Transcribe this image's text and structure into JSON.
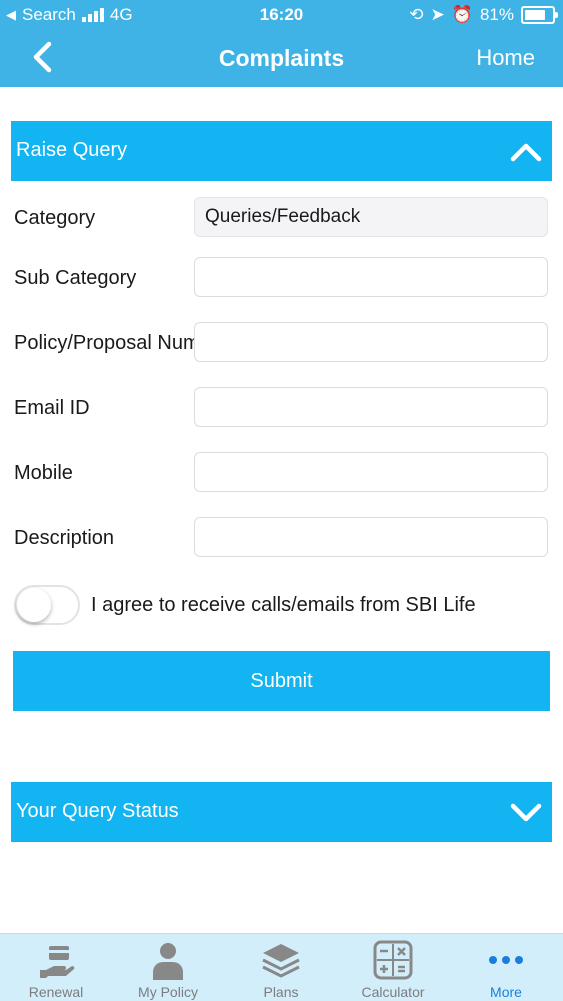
{
  "status_bar": {
    "carrier": "Search",
    "network": "4G",
    "time": "16:20",
    "battery": "81%"
  },
  "nav": {
    "title": "Complaints",
    "right_label": "Home",
    "back_icon": "chevron-left-icon"
  },
  "raise_query": {
    "title": "Raise Query",
    "expanded": true,
    "fields": [
      {
        "label": "Category",
        "value": "Queries/Feedback",
        "placeholder": ""
      },
      {
        "label": "Sub Category",
        "value": "",
        "placeholder": ""
      },
      {
        "label": "Policy/Proposal Number",
        "value": "",
        "placeholder": ""
      },
      {
        "label": "Email ID",
        "value": "",
        "placeholder": ""
      },
      {
        "label": "Mobile",
        "value": "",
        "placeholder": ""
      },
      {
        "label": "Description",
        "value": "",
        "placeholder": ""
      }
    ],
    "consent_label": "I agree to receive calls/emails from SBI Life",
    "consent_on": false,
    "submit_label": "Submit"
  },
  "query_status": {
    "title": "Your Query Status",
    "expanded": false
  },
  "tabs": [
    {
      "label": "Renewal",
      "icon": "renewal-icon",
      "active": false
    },
    {
      "label": "My Policy",
      "icon": "person-icon",
      "active": false
    },
    {
      "label": "Plans",
      "icon": "layers-icon",
      "active": false
    },
    {
      "label": "Calculator",
      "icon": "calculator-icon",
      "active": false
    },
    {
      "label": "More",
      "icon": "more-dots-icon",
      "active": true
    }
  ],
  "colors": {
    "header": "#3fb3e6",
    "accent": "#12b5f2",
    "tab_active": "#1a7fdc",
    "tabbar_bg": "#d3eefb"
  }
}
